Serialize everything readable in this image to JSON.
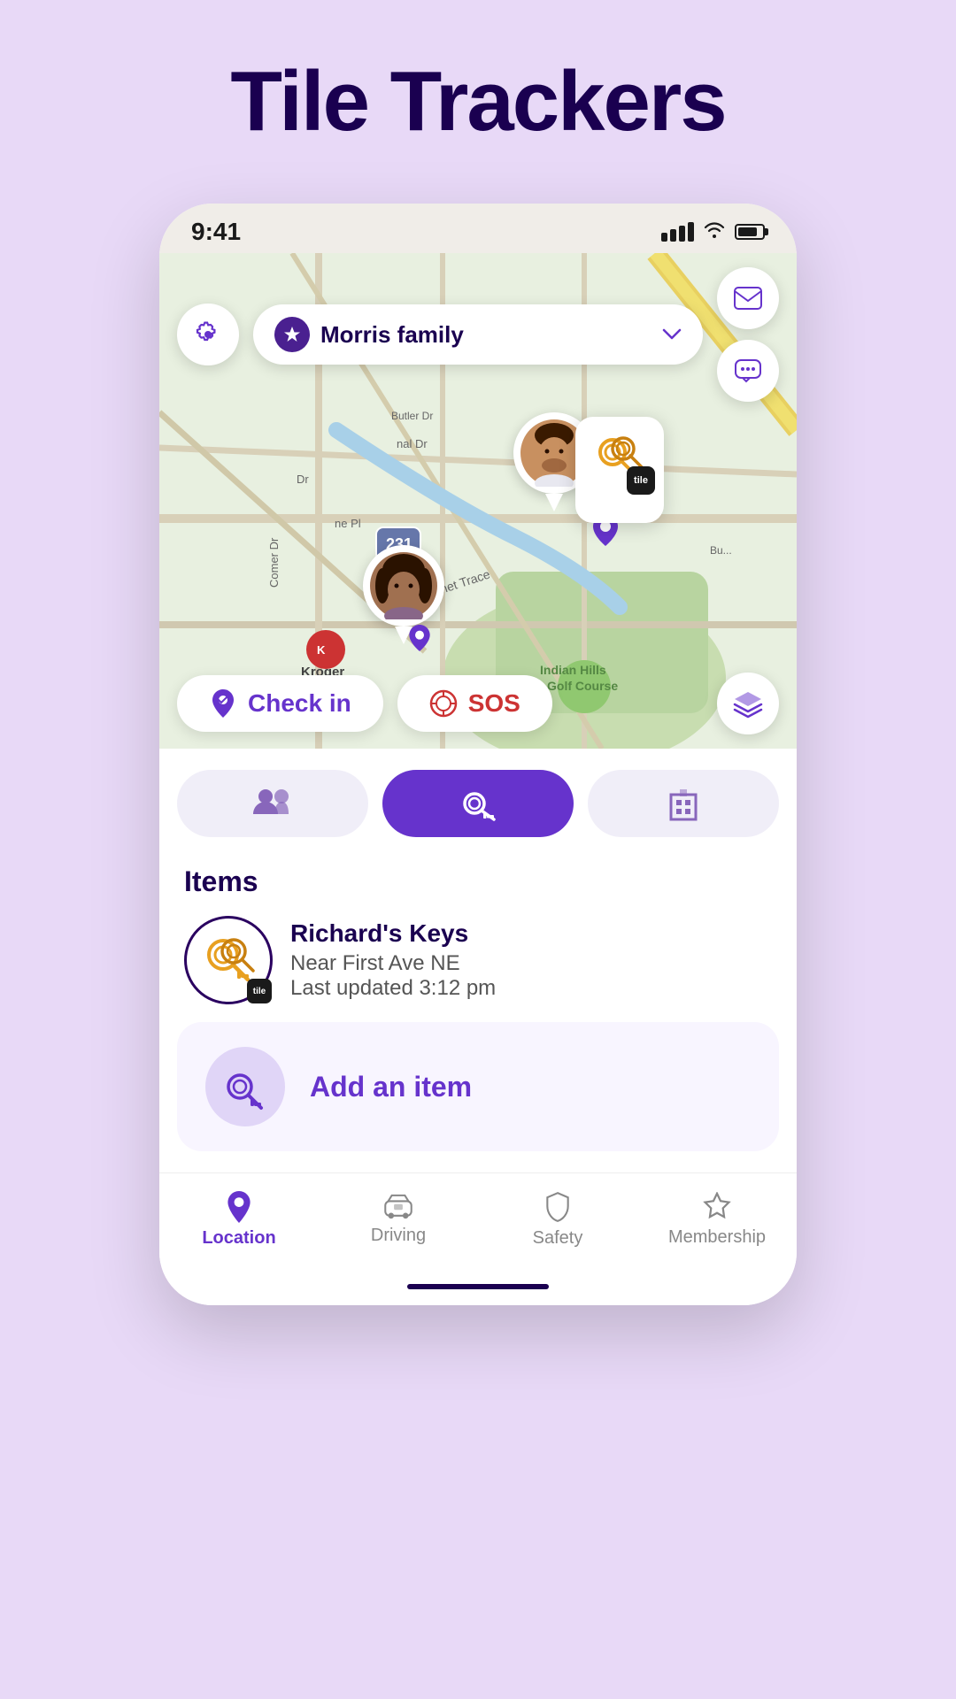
{
  "page": {
    "title": "Tile Trackers",
    "background_color": "#e8d9f7"
  },
  "status_bar": {
    "time": "9:41",
    "signal_strength": 4,
    "wifi": true,
    "battery_percent": 80
  },
  "map": {
    "family_group": "Morris family",
    "checkin_label": "Check in",
    "sos_label": "SOS",
    "location_pin": "📍"
  },
  "tabs": {
    "people_icon": "👥",
    "tile_icon": "🔑",
    "building_icon": "🏢"
  },
  "items": {
    "section_title": "Items",
    "list": [
      {
        "name": "Richard's Keys",
        "location": "Near First Ave NE",
        "last_updated": "Last updated 3:12 pm"
      }
    ]
  },
  "add_item": {
    "label": "Add an item"
  },
  "bottom_nav": {
    "items": [
      {
        "id": "location",
        "label": "Location",
        "active": true
      },
      {
        "id": "driving",
        "label": "Driving",
        "active": false
      },
      {
        "id": "safety",
        "label": "Safety",
        "active": false
      },
      {
        "id": "membership",
        "label": "Membership",
        "active": false
      }
    ]
  },
  "icons": {
    "gear": "⚙",
    "mail": "✉",
    "chat": "💬",
    "layers": "◧",
    "checkin": "✔",
    "sos": "⊕",
    "star": "★",
    "chevron_down": "⌄",
    "location_filled": "📍",
    "driving": "🚗",
    "shield": "🛡",
    "star_outline": "☆",
    "key": "🔑",
    "people": "👥",
    "building": "🏢",
    "pin": "📍"
  }
}
